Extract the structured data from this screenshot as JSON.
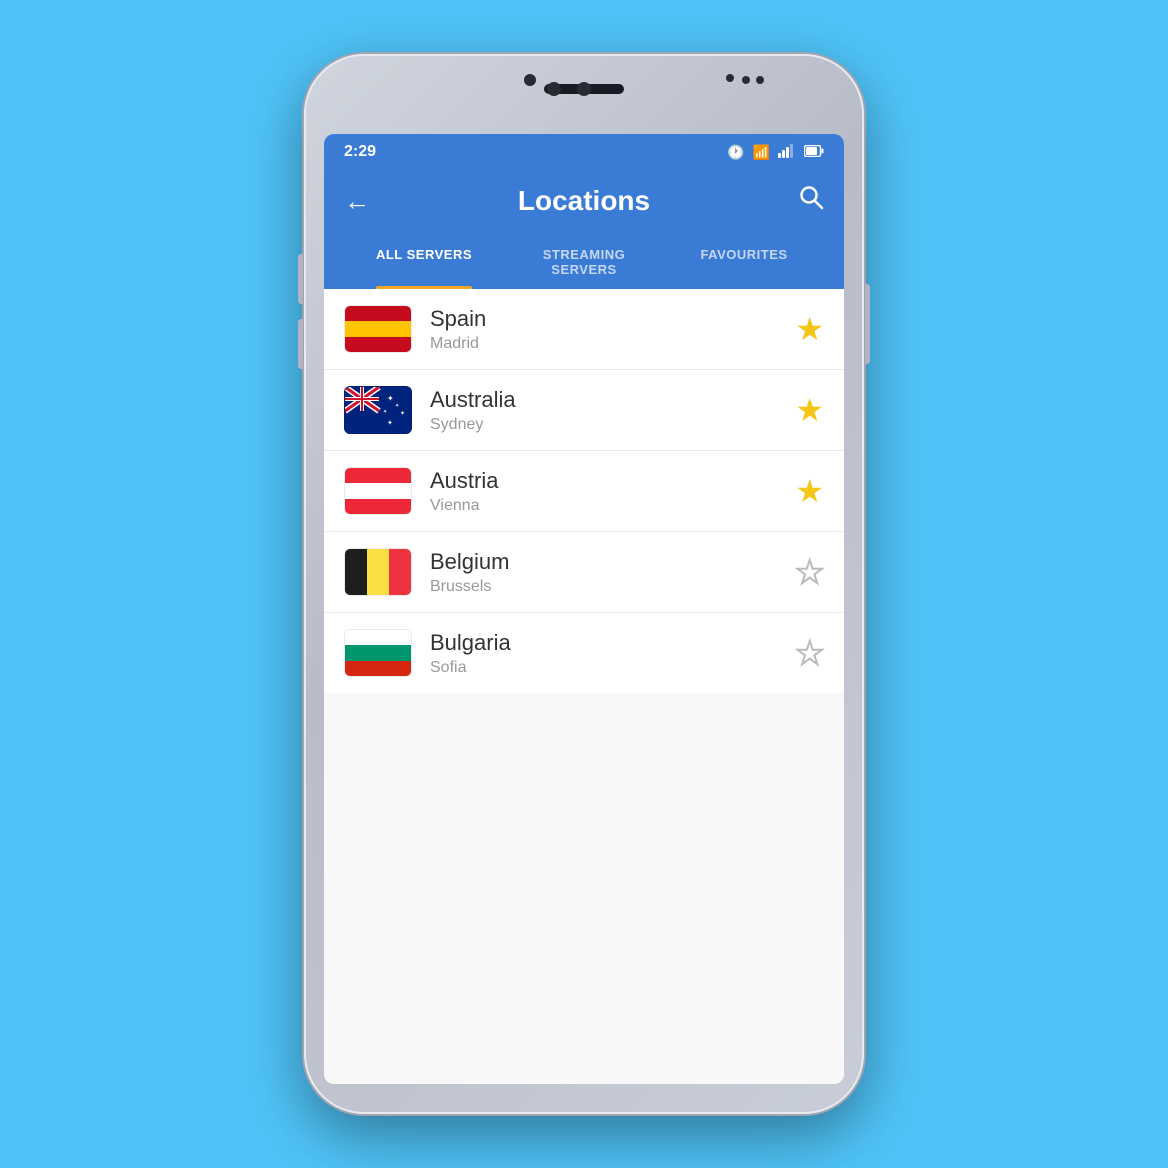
{
  "status_bar": {
    "time": "2:29",
    "icons": [
      "🕐",
      "📶",
      "📶",
      "🔋"
    ]
  },
  "header": {
    "back_label": "←",
    "title": "Locations",
    "search_label": "🔍"
  },
  "tabs": [
    {
      "id": "all",
      "label": "ALL SERVERS",
      "active": true
    },
    {
      "id": "streaming",
      "label": "STREAMING SERVERS",
      "active": false
    },
    {
      "id": "favourites",
      "label": "FAVOURITES",
      "active": false
    }
  ],
  "locations": [
    {
      "country": "Spain",
      "city": "Madrid",
      "flag": "spain",
      "favourite": true
    },
    {
      "country": "Australia",
      "city": "Sydney",
      "flag": "australia",
      "favourite": true
    },
    {
      "country": "Austria",
      "city": "Vienna",
      "flag": "austria",
      "favourite": true
    },
    {
      "country": "Belgium",
      "city": "Brussels",
      "flag": "belgium",
      "favourite": false
    },
    {
      "country": "Bulgaria",
      "city": "Sofia",
      "flag": "bulgaria",
      "favourite": false
    }
  ],
  "colors": {
    "header_bg": "#3a7bd5",
    "tab_active_indicator": "#f5a623",
    "star_filled": "#f5c518",
    "star_empty": "#bbb"
  }
}
